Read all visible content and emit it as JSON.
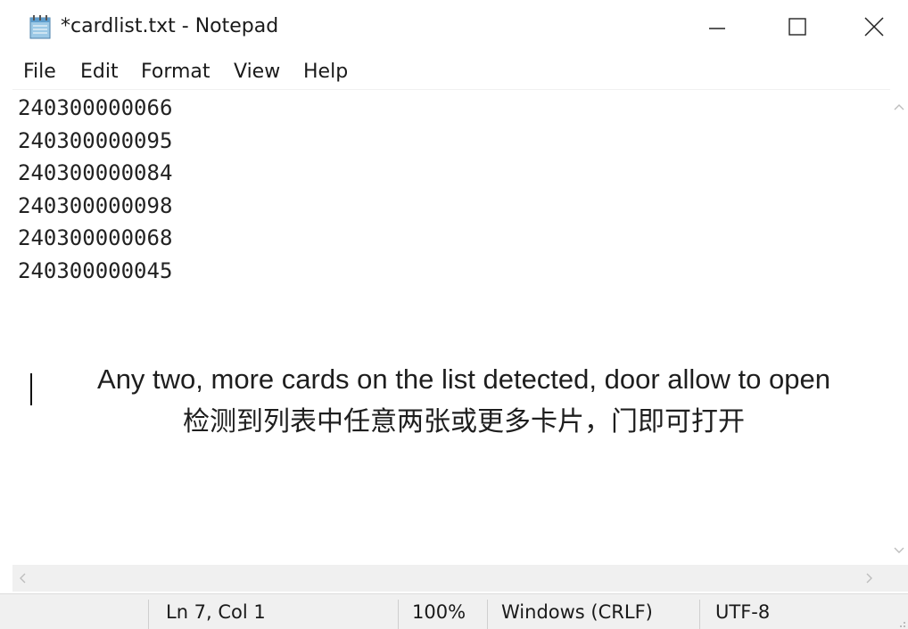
{
  "window": {
    "title": "*cardlist.txt - Notepad",
    "icon": "notepad-icon"
  },
  "menu": {
    "items": [
      "File",
      "Edit",
      "Format",
      "View",
      "Help"
    ]
  },
  "editor": {
    "lines": [
      "240300000066",
      "240300000095",
      "240300000084",
      "240300000098",
      "240300000068",
      "240300000045"
    ]
  },
  "overlay": {
    "english": "Any two, more cards on the list detected, door allow to open",
    "chinese": "检测到列表中任意两张或更多卡片，门即可打开"
  },
  "status": {
    "position": "Ln 7, Col 1",
    "zoom": "100%",
    "line_ending": "Windows (CRLF)",
    "encoding": "UTF-8"
  },
  "colors": {
    "background": "#ffffff",
    "chrome": "#f0f0f0",
    "text": "#1a1a1a"
  }
}
